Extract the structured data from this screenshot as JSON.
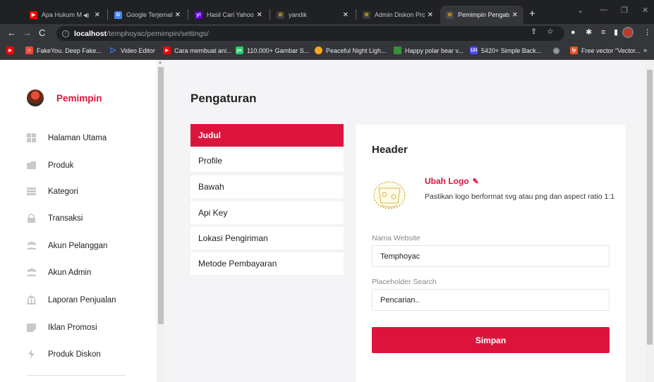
{
  "browser": {
    "tabs": [
      {
        "label": "Apa Hukum M",
        "icon": "youtube-icon",
        "color": "#ff0000",
        "active": false
      },
      {
        "label": "Google Terjemahan",
        "icon": "google-translate-icon",
        "color": "#4285f4",
        "active": false
      },
      {
        "label": "Hasil Cari Yahoo un",
        "icon": "yahoo-icon",
        "color": "#6001d2",
        "active": false
      },
      {
        "label": "yandik",
        "icon": "site-icon",
        "color": "#e0a000",
        "active": false
      },
      {
        "label": "Admin Diskon Prod",
        "icon": "site-icon",
        "color": "#e0a000",
        "active": false
      },
      {
        "label": "Pemimpin Pengatur",
        "icon": "site-icon",
        "color": "#e0a000",
        "active": true
      }
    ],
    "url_host": "localhost",
    "url_path": "/temphoyac/pemimpin/settings/",
    "bookmarks": [
      {
        "label": "",
        "icon": "youtube-icon",
        "color": "#ff0000"
      },
      {
        "label": "FakeYou. Deep Fake...",
        "icon": "fakeyou-icon",
        "color": "#e74c3c"
      },
      {
        "label": "Video Editor",
        "icon": "play-icon",
        "color": "#4a7dfc"
      },
      {
        "label": "Cara membuat ani...",
        "icon": "youtube-icon",
        "color": "#ff0000"
      },
      {
        "label": "110.000+ Gambar S...",
        "icon": "pixabay-icon",
        "color": "#2ec66d"
      },
      {
        "label": "Peaceful Night Ligh...",
        "icon": "site-icon",
        "color": "#f5a623"
      },
      {
        "label": "Happy polar bear v...",
        "icon": "site-icon",
        "color": "#3a8f3a"
      },
      {
        "label": "5420+ Simple Back...",
        "icon": "site-icon",
        "color": "#4a4aff"
      },
      {
        "label": "",
        "icon": "globe-icon",
        "color": "#9aa0a6"
      },
      {
        "label": "Free vector \"Vector...",
        "icon": "site-icon",
        "color": "#e8542a"
      }
    ]
  },
  "sidebar": {
    "brand": "Pemimpin",
    "items": [
      {
        "label": "Halaman Utama",
        "icon": "dashboard-icon"
      },
      {
        "label": "Produk",
        "icon": "folder-icon"
      },
      {
        "label": "Kategori",
        "icon": "list-icon"
      },
      {
        "label": "Transaksi",
        "icon": "lock-icon"
      },
      {
        "label": "Akun Pelanggan",
        "icon": "users-icon"
      },
      {
        "label": "Akun Admin",
        "icon": "users-icon"
      },
      {
        "label": "Laporan Penjualan",
        "icon": "bank-icon"
      },
      {
        "label": "Iklan Promosi",
        "icon": "card-icon"
      },
      {
        "label": "Produk Diskon",
        "icon": "bolt-icon"
      }
    ]
  },
  "main": {
    "title": "Pengaturan",
    "menu": [
      "Judul",
      "Profile",
      "Bawah",
      "Api Key",
      "Lokasi Pengiriman",
      "Metode Pembayaran"
    ],
    "active_menu": "Judul"
  },
  "card": {
    "title": "Header",
    "change_logo": "Ubah Logo",
    "logo_hint": "Pastikan logo berformat svg atau png dan aspect ratio 1:1",
    "site_name_label": "Nama Website",
    "site_name_value": "Temphoyac",
    "placeholder_label": "Placeholder Search",
    "placeholder_value": "Pencarian..",
    "save_label": "Simpan"
  },
  "colors": {
    "accent": "#dc143c"
  }
}
